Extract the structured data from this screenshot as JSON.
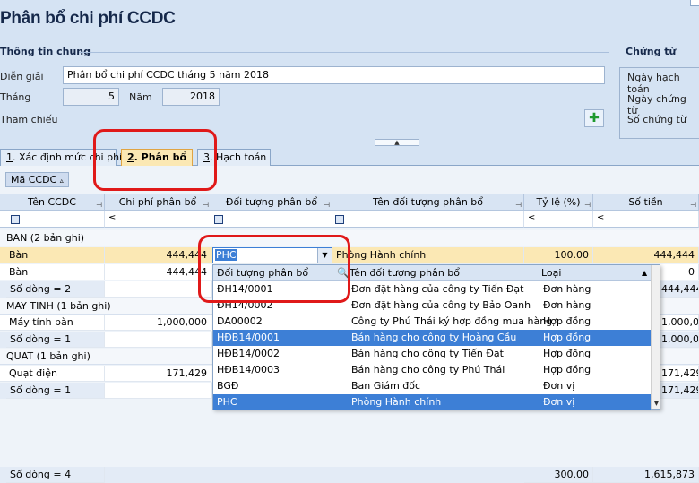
{
  "title": "Phân bổ chi phí CCDC",
  "general": {
    "section_label": "Thông tin chung",
    "dien_giai_label": "Diễn giải",
    "dien_giai_value": "Phân bổ chi phí CCDC tháng 5 năm 2018",
    "thang_label": "Tháng",
    "thang_value": "5",
    "nam_label": "Năm",
    "nam_value": "2018",
    "tham_chieu_label": "Tham chiếu"
  },
  "voucher": {
    "section_label": "Chứng từ",
    "ngay_hach_toan": "Ngày hạch toán",
    "ngay_chung_tu": "Ngày chứng từ",
    "so_chung_tu": "Số chứng từ"
  },
  "tabs": [
    {
      "num": "1",
      "label": ". Xác định mức chi phí"
    },
    {
      "num": "2",
      "label": ". Phân bổ"
    },
    {
      "num": "3",
      "label": ". Hạch toán"
    }
  ],
  "group_chip": "Mã CCDC",
  "columns": [
    "Tên CCDC",
    "Chi phí phân bổ",
    "Đối tượng phân bổ",
    "Tên đối tượng phân bổ",
    "Tỷ lệ (%)",
    "Số tiền"
  ],
  "filter_le": "≤",
  "grid": {
    "groups": [
      {
        "label": "BAN (2 bản ghi)"
      },
      {
        "label": "MAY TINH (1 bản ghi)"
      },
      {
        "label": "QUAT (1 bản ghi)"
      }
    ],
    "rows": [
      {
        "name": "Bàn",
        "cost": "444,444",
        "obj": "PHC",
        "obj_name": "Phòng Hành chính",
        "ratio": "100.00",
        "amount": "444,444"
      },
      {
        "name": "Bàn",
        "cost": "444,444",
        "amount": "0"
      },
      {
        "sum_label": "Số dòng = 2",
        "amount": "444,444"
      },
      {
        "name": "Máy tính bàn",
        "cost": "1,000,000",
        "amount": "1,000,000"
      },
      {
        "sum_label": "Số dòng = 1",
        "amount": "1,000,000"
      },
      {
        "name": "Quạt điện",
        "cost": "171,429",
        "amount": "171,429"
      },
      {
        "sum_label": "Số dòng = 1",
        "amount": "171,429"
      }
    ],
    "footer": {
      "label": "Số dòng = 4",
      "ratio": "300.00",
      "amount": "1,615,873"
    }
  },
  "dropdown": {
    "headers": [
      "Đối tượng phân bổ",
      "Tên đối tượng phân bổ",
      "Loại"
    ],
    "rows": [
      {
        "code": "ĐH14/0001",
        "name": "Đơn đặt hàng của công ty Tiến Đạt",
        "type": "Đơn hàng"
      },
      {
        "code": "ĐH14/0002",
        "name": "Đơn đặt hàng của công ty Bảo Oanh",
        "type": "Đơn hàng"
      },
      {
        "code": "DA00002",
        "name": "Công ty Phú Thái ký hợp đồng mua hàng",
        "type": "Hợp đồng"
      },
      {
        "code": "HĐB14/0001",
        "name": "Bán hàng cho công ty Hoàng Cầu",
        "type": "Hợp đồng"
      },
      {
        "code": "HĐB14/0002",
        "name": "Bán hàng cho công ty Tiến Đạt",
        "type": "Hợp đồng"
      },
      {
        "code": "HĐB14/0003",
        "name": "Bán hàng cho công ty Phú Thái",
        "type": "Hợp đồng"
      },
      {
        "code": "BGĐ",
        "name": "Ban Giám đốc",
        "type": "Đơn vị"
      },
      {
        "code": "PHC",
        "name": "Phòng Hành chính",
        "type": "Đơn vị"
      }
    ]
  }
}
